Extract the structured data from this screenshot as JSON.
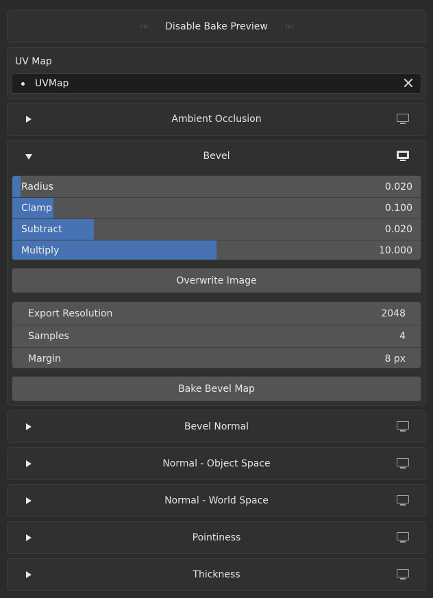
{
  "top_button": {
    "label": "Disable Bake Preview",
    "grip_left": "::::",
    "grip_right": "::::"
  },
  "uv_map": {
    "label": "UV Map",
    "value": "UVMap"
  },
  "panels": {
    "ambient_occlusion": {
      "title": "Ambient Occlusion",
      "expanded": false,
      "preview_enabled": false
    },
    "bevel": {
      "title": "Bevel",
      "expanded": true,
      "preview_enabled": true,
      "sliders": [
        {
          "label": "Radius",
          "value": "0.020",
          "fill": 0.02
        },
        {
          "label": "Clamp",
          "value": "0.100",
          "fill": 0.1
        },
        {
          "label": "Subtract",
          "value": "0.020",
          "fill": 0.2
        },
        {
          "label": "Multiply",
          "value": "10.000",
          "fill": 0.5
        }
      ],
      "overwrite_label": "Overwrite Image",
      "props": [
        {
          "label": "Export Resolution",
          "value": "2048"
        },
        {
          "label": "Samples",
          "value": "4"
        },
        {
          "label": "Margin",
          "value": "8 px"
        }
      ],
      "bake_label": "Bake Bevel Map"
    },
    "bevel_normal": {
      "title": "Bevel Normal",
      "expanded": false,
      "preview_enabled": false
    },
    "normal_object": {
      "title": "Normal - Object Space",
      "expanded": false,
      "preview_enabled": false
    },
    "normal_world": {
      "title": "Normal - World Space",
      "expanded": false,
      "preview_enabled": false
    },
    "pointiness": {
      "title": "Pointiness",
      "expanded": false,
      "preview_enabled": false
    },
    "thickness": {
      "title": "Thickness",
      "expanded": false,
      "preview_enabled": false
    }
  },
  "colors": {
    "background": "#2b2b2b",
    "panel": "#303030",
    "accent": "#4772b3",
    "field": "#545454"
  }
}
